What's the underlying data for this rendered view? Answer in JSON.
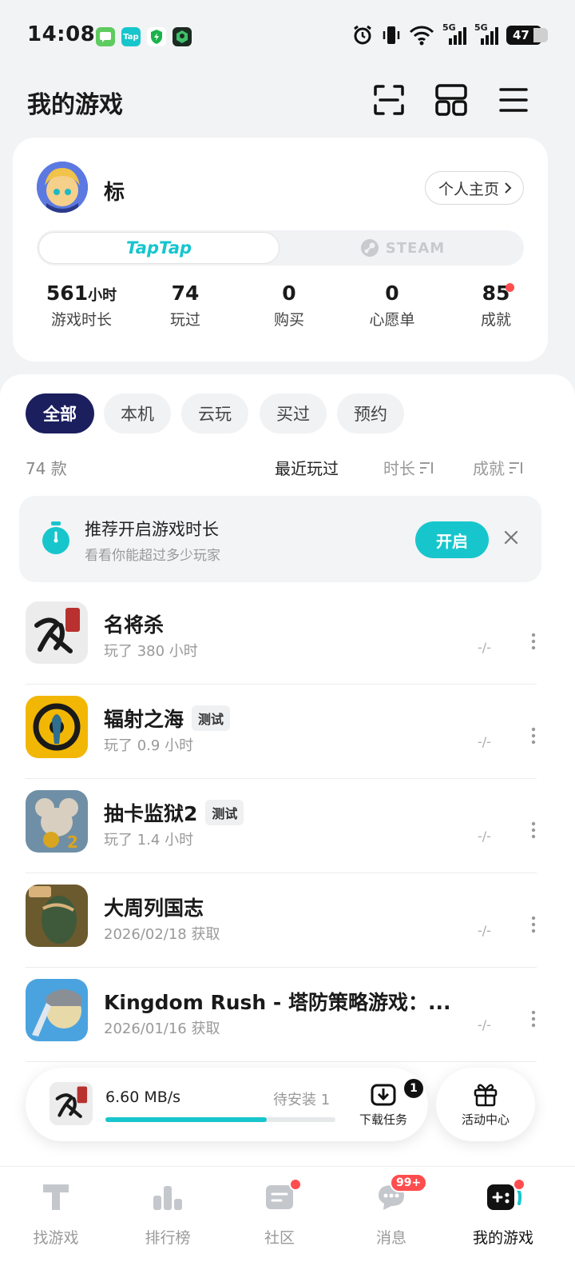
{
  "status_bar": {
    "time": "14:08",
    "battery": "47",
    "signal_1": "5G",
    "signal_2": "5G",
    "app_icons": [
      "chat-app-icon",
      "taptap-app-icon",
      "shield-app-icon",
      "game-app-icon"
    ],
    "tap_icon_label": "Tap"
  },
  "header": {
    "title": "我的游戏",
    "icons": [
      "scan-icon",
      "layout-icon",
      "menu-icon"
    ]
  },
  "profile": {
    "username": "标",
    "homepage_button": "个人主页",
    "platforms": {
      "taptap": "TapTap",
      "steam": "STEAM"
    },
    "stats": [
      {
        "value": "561",
        "unit": "小时",
        "label": "游戏时长"
      },
      {
        "value": "74",
        "unit": "",
        "label": "玩过"
      },
      {
        "value": "0",
        "unit": "",
        "label": "购买"
      },
      {
        "value": "0",
        "unit": "",
        "label": "心愿单"
      },
      {
        "value": "85",
        "unit": "",
        "label": "成就"
      }
    ]
  },
  "filters": {
    "chips": [
      "全部",
      "本机",
      "云玩",
      "买过",
      "预约"
    ],
    "active_index": 0,
    "count": "74 款",
    "sorts": [
      "最近玩过",
      "时长",
      "成就"
    ]
  },
  "banner": {
    "title": "推荐开启游戏时长",
    "subtitle": "看看你能超过多少玩家",
    "button": "开启"
  },
  "games": [
    {
      "title": "名将杀",
      "badge": "",
      "subtitle": "玩了 380 小时",
      "achievement": "-/-",
      "icon_colors": [
        "#e8e8e8",
        "#1a1a1a",
        "#b8312f"
      ]
    },
    {
      "title": "辐射之海",
      "badge": "测试",
      "subtitle": "玩了 0.9 小时",
      "achievement": "-/-",
      "icon_colors": [
        "#f2b705",
        "#1a1a1a",
        "#2f6f8f"
      ]
    },
    {
      "title": "抽卡监狱2",
      "badge": "测试",
      "subtitle": "玩了 1.4 小时",
      "achievement": "-/-",
      "icon_colors": [
        "#6f8fa6",
        "#d9cfc0",
        "#d9a520"
      ]
    },
    {
      "title": "大周列国志",
      "badge": "",
      "subtitle": "2026/02/18 获取",
      "achievement": "-/-",
      "icon_colors": [
        "#6b5a2e",
        "#3f5a3a",
        "#d8b27a"
      ]
    },
    {
      "title": "Kingdom Rush - 塔防策略游戏：...",
      "badge": "",
      "subtitle": "2026/01/16 获取",
      "achievement": "-/-",
      "icon_colors": [
        "#4aa3df",
        "#e8d9a8",
        "#2d5d8a"
      ]
    }
  ],
  "download": {
    "speed": "6.60 MB/s",
    "pending": "待安装 1",
    "progress": 0.7,
    "task_label": "下载任务",
    "task_count": "1",
    "event_label": "活动中心"
  },
  "bottom_nav": {
    "items": [
      "找游戏",
      "排行榜",
      "社区",
      "消息",
      "我的游戏"
    ],
    "active_index": 4,
    "message_badge": "99+"
  },
  "colors": {
    "accent": "#17c6cc",
    "active_chip": "#1b1f5e",
    "badge_red": "#ff4d4f"
  }
}
